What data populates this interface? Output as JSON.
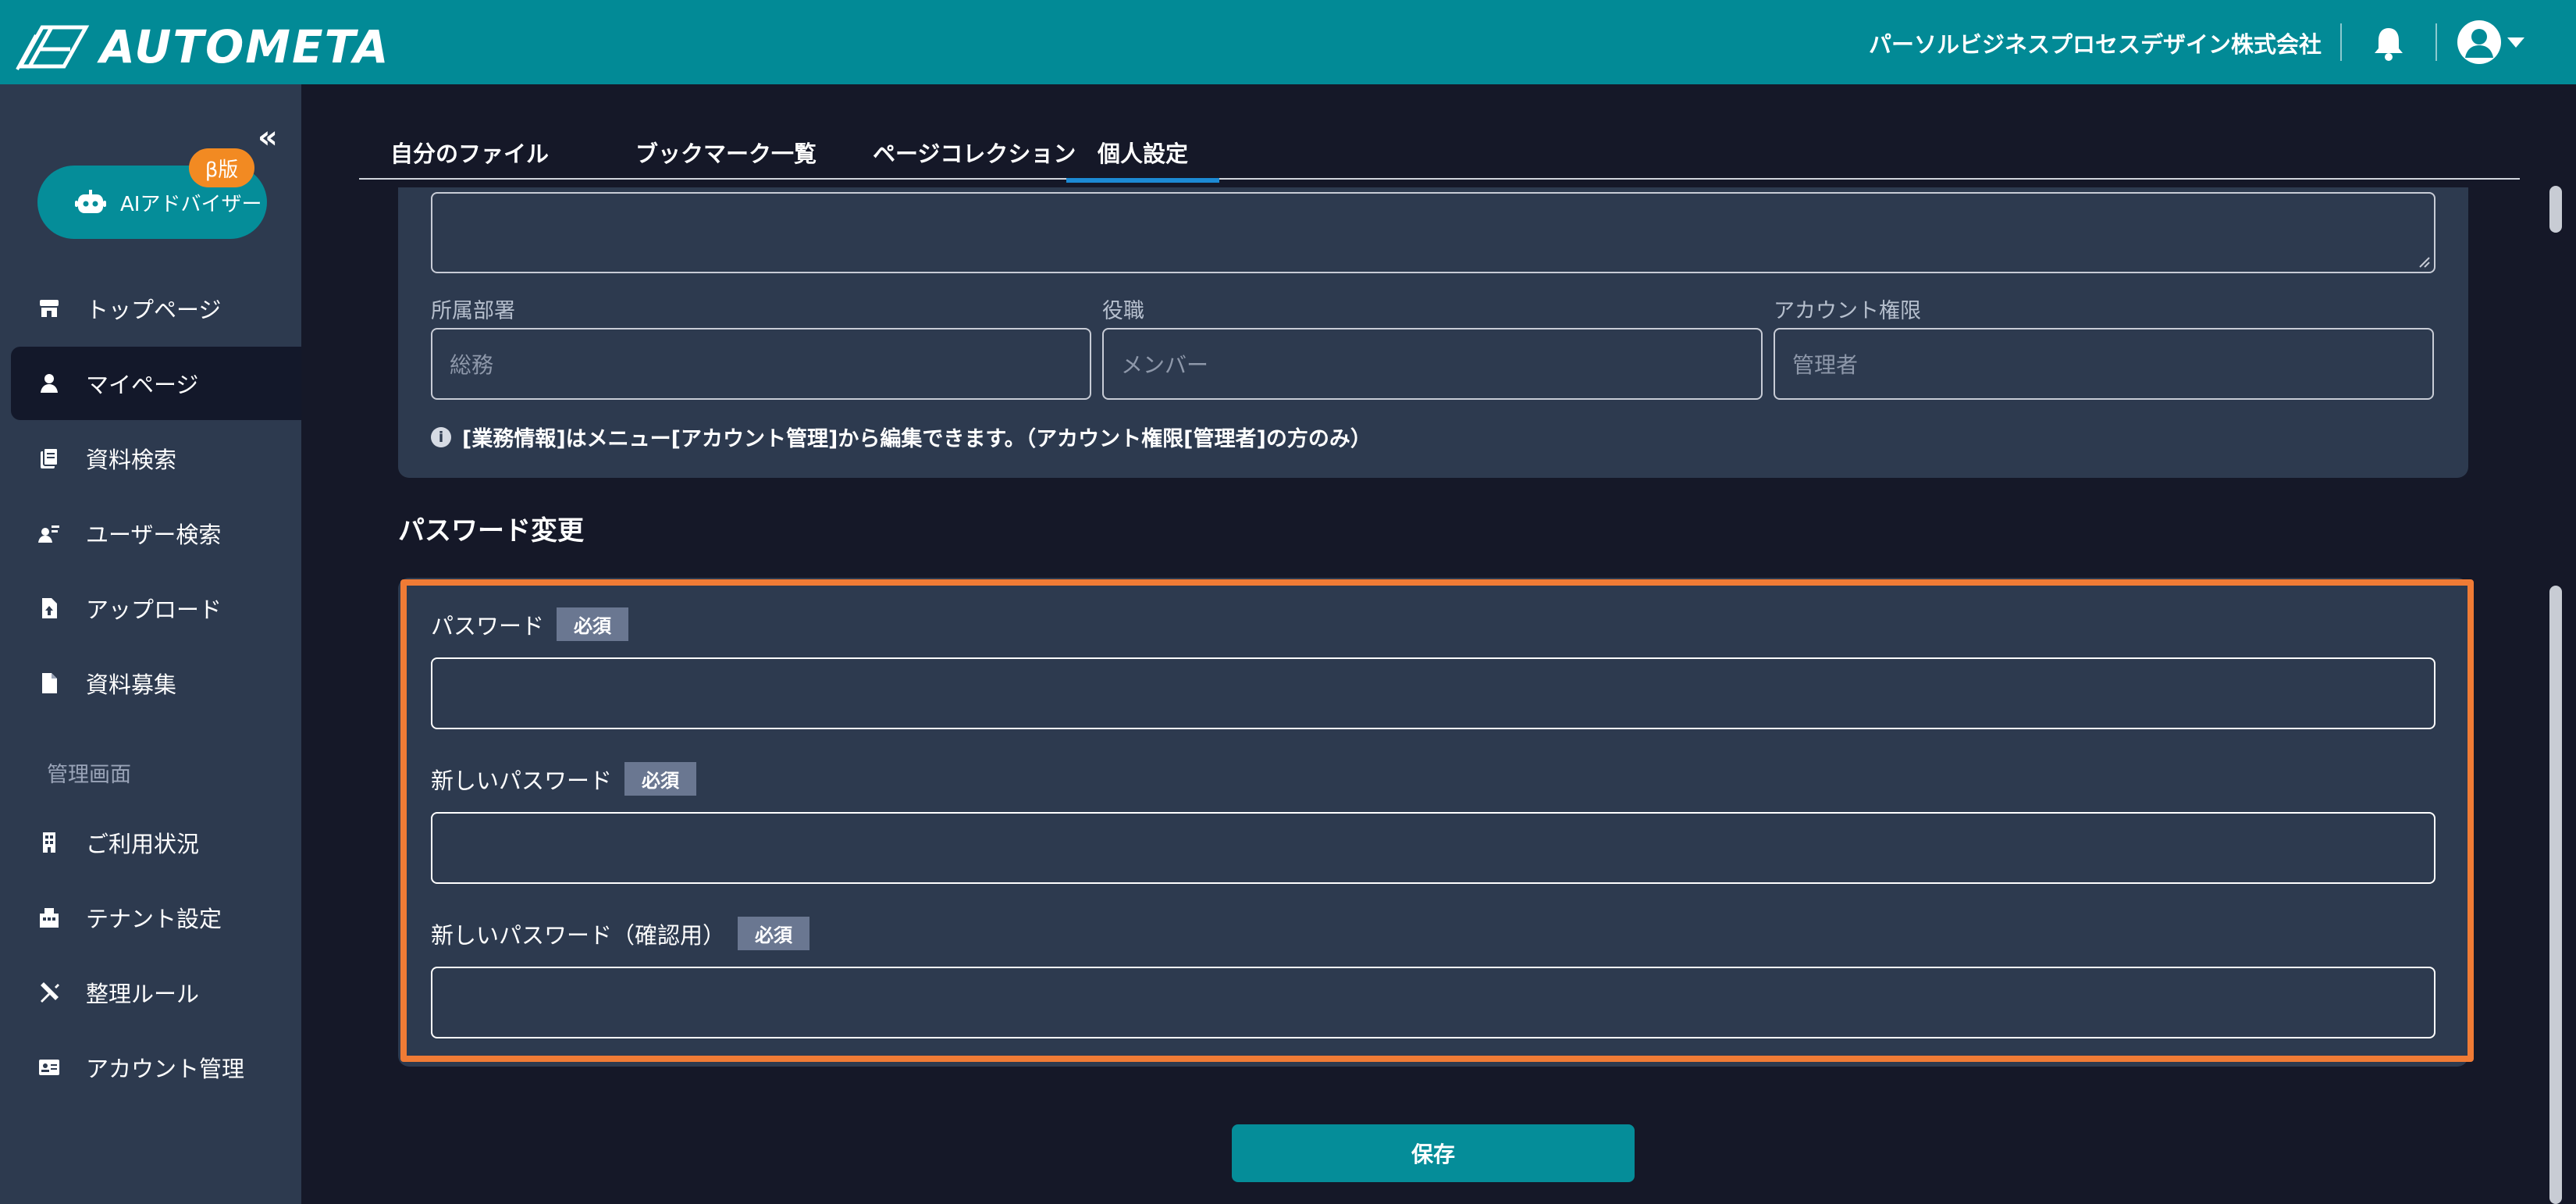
{
  "header": {
    "logo_text": "AUTOMETA",
    "company": "パーソルビジネスプロセスデザイン株式会社"
  },
  "sidebar": {
    "ai_button": {
      "label": "AIアドバイザー",
      "badge": "β版"
    },
    "items": [
      {
        "label": "トップページ",
        "icon": "store-icon"
      },
      {
        "label": "マイページ",
        "icon": "user-icon",
        "active": true
      },
      {
        "label": "資料検索",
        "icon": "document-search-icon"
      },
      {
        "label": "ユーザー検索",
        "icon": "user-search-icon"
      },
      {
        "label": "アップロード",
        "icon": "upload-file-icon"
      },
      {
        "label": "資料募集",
        "icon": "file-icon"
      }
    ],
    "admin_section_label": "管理画面",
    "admin_items": [
      {
        "label": "ご利用状況",
        "icon": "building-icon"
      },
      {
        "label": "テナント設定",
        "icon": "tenant-icon"
      },
      {
        "label": "整理ルール",
        "icon": "tools-icon"
      },
      {
        "label": "アカウント管理",
        "icon": "id-card-icon"
      }
    ]
  },
  "tabs": [
    {
      "label": "自分のファイル"
    },
    {
      "label": "ブックマーク一覧"
    },
    {
      "label": "ページコレクション"
    },
    {
      "label": "個人設定",
      "active": true
    }
  ],
  "profile": {
    "fields": [
      {
        "label": "所属部署",
        "value": "総務"
      },
      {
        "label": "役職",
        "value": "メンバー"
      },
      {
        "label": "アカウント権限",
        "value": "管理者"
      }
    ],
    "info_text": "[業務情報]はメニュー[アカウント管理]から編集できます。（アカウント権限[管理者]の方のみ）"
  },
  "password_section": {
    "title": "パスワード変更",
    "required_badge": "必須",
    "fields": [
      {
        "label": "パスワード",
        "value": ""
      },
      {
        "label": "新しいパスワード",
        "value": ""
      },
      {
        "label": "新しいパスワード（確認用）",
        "value": ""
      }
    ]
  },
  "save_label": "保存",
  "colors": {
    "header": "#028a96",
    "sidebar": "#2d3a4f",
    "background": "#151828",
    "accent_highlight": "#f07b35",
    "beta_badge": "#f28a22",
    "tab_underline": "#1c8ad4"
  }
}
